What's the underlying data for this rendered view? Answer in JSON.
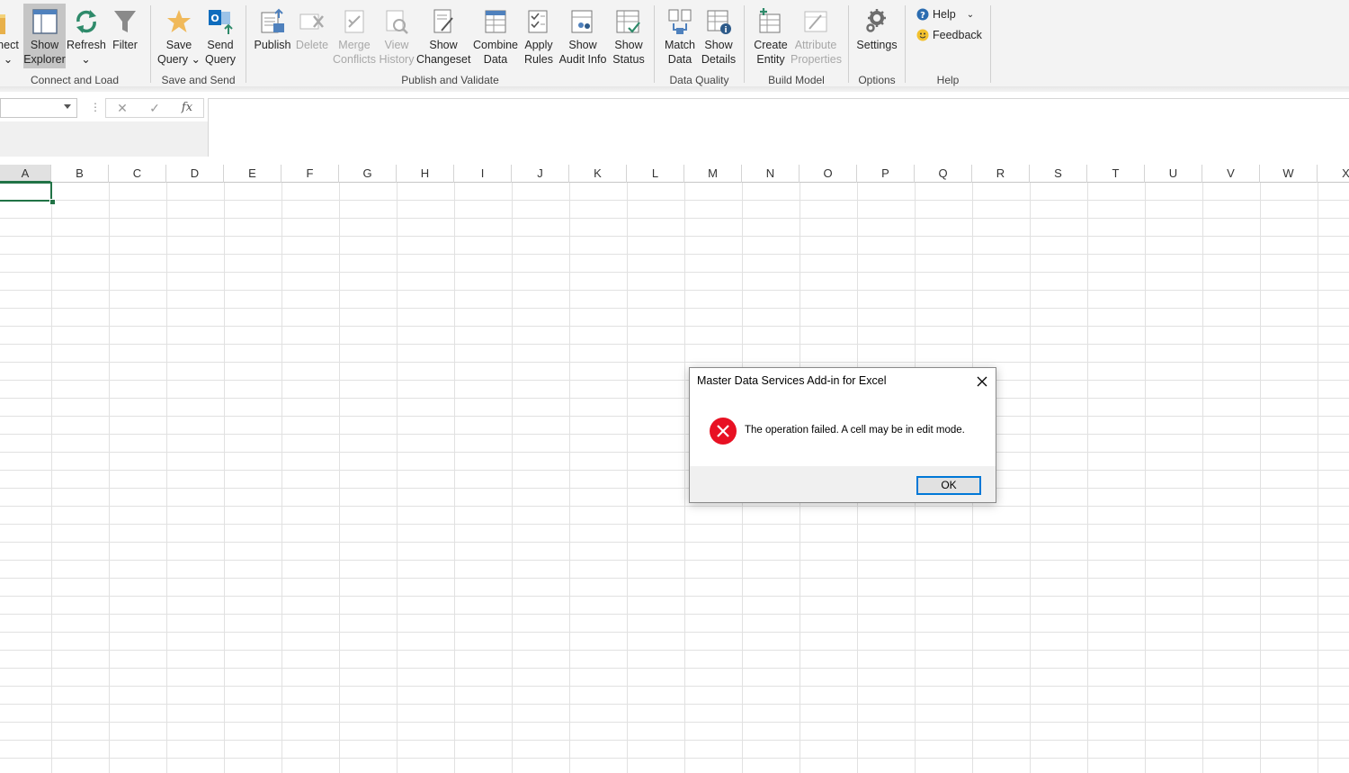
{
  "ribbon": {
    "groups": {
      "connect_load": "Connect and Load",
      "save_send": "Save and Send",
      "publish_validate": "Publish and Validate",
      "data_quality": "Data Quality",
      "build_model": "Build Model",
      "options": "Options",
      "help": "Help"
    },
    "buttons": {
      "connect": [
        "nect",
        ""
      ],
      "show_explorer": [
        "Show",
        "Explorer"
      ],
      "refresh": [
        "Refresh",
        ""
      ],
      "filter": [
        "Filter",
        ""
      ],
      "save_query": [
        "Save",
        "Query"
      ],
      "send_query": [
        "Send",
        "Query"
      ],
      "publish": [
        "Publish",
        ""
      ],
      "delete": [
        "Delete",
        ""
      ],
      "merge_conflicts": [
        "Merge",
        "Conflicts"
      ],
      "view_history": [
        "View",
        "History"
      ],
      "show_changeset": [
        "Show",
        "Changeset"
      ],
      "combine_data": [
        "Combine",
        "Data"
      ],
      "apply_rules": [
        "Apply",
        "Rules"
      ],
      "show_audit_info": [
        "Show",
        "Audit Info"
      ],
      "show_status": [
        "Show",
        "Status"
      ],
      "match_data": [
        "Match",
        "Data"
      ],
      "show_details": [
        "Show",
        "Details"
      ],
      "create_entity": [
        "Create",
        "Entity"
      ],
      "attribute_properties": [
        "Attribute",
        "Properties"
      ],
      "settings": [
        "Settings",
        ""
      ]
    },
    "help_menu": {
      "help": "Help",
      "feedback": "Feedback"
    }
  },
  "formula_bar": {
    "name_box": "",
    "cancel": "✕",
    "enter": "✓",
    "fx": "fx",
    "formula": ""
  },
  "columns": [
    "A",
    "B",
    "C",
    "D",
    "E",
    "F",
    "G",
    "H",
    "I",
    "J",
    "K",
    "L",
    "M",
    "N",
    "O",
    "P",
    "Q",
    "R",
    "S",
    "T",
    "U",
    "V",
    "W",
    "X"
  ],
  "dialog": {
    "title": "Master Data Services Add-in for Excel",
    "message": "The operation failed. A cell may be in edit mode.",
    "ok": "OK"
  },
  "colors": {
    "accent": "#217346",
    "dialog_focus": "#0078d7",
    "error": "#e81123"
  }
}
